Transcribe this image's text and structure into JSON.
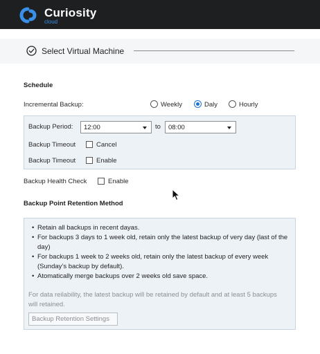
{
  "brand": {
    "name": "Curiosity",
    "sub": "cloud",
    "accent": "#3a8fe8"
  },
  "step": {
    "title": "Select Virtual Machine"
  },
  "schedule": {
    "title": "Schedule",
    "incremental_label": "Incremental Backup:",
    "frequency_options": [
      "Weekly",
      "Daly",
      "Hourly"
    ],
    "frequency_selected": "Daly",
    "period_label": "Backup Period:",
    "period_start": "12:00",
    "period_to": "to",
    "period_end": "08:00",
    "timeout1_label": "Backup Timeout",
    "timeout1_option": "Cancel",
    "timeout2_label": "Backup Timeout",
    "timeout2_option": "Enable",
    "health_label": "Backup Health Check",
    "health_option": "Enable"
  },
  "retention": {
    "title": "Backup Point Retention Method",
    "bullets": [
      "Retain all backups in recent dayas.",
      "For backups 3 days to 1 week old, retain only the latest backup of very day (last of the day)",
      "For backups 1 week to 2 weeks old, retain only the latest backup of every week (Sunday’s backup by default).",
      "Atomatically merge backups over 2 weeks old save space."
    ],
    "note": "For data reilability, the latest backup will be retained by default and at least 5 backups will retained.",
    "settings_button": "Backup Retention Settings"
  }
}
